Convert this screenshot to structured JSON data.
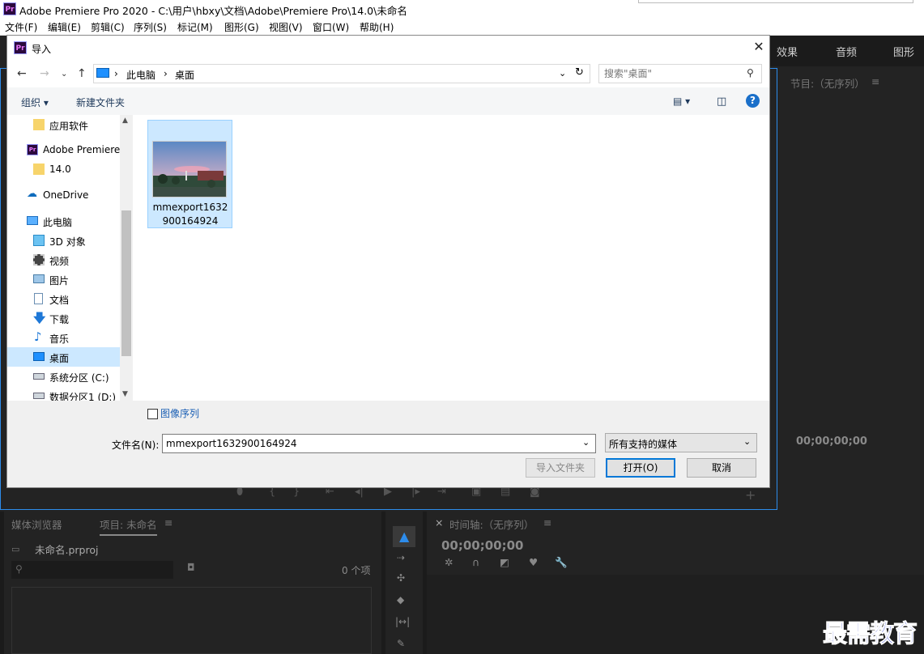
{
  "app": {
    "title": "Adobe Premiere Pro 2020 - C:\\用户\\hbxy\\文档\\Adobe\\Premiere Pro\\14.0\\未命名",
    "logo": "Pr"
  },
  "menu": [
    "文件(F)",
    "编辑(E)",
    "剪辑(C)",
    "序列(S)",
    "标记(M)",
    "图形(G)",
    "视图(V)",
    "窗口(W)",
    "帮助(H)"
  ],
  "premiere": {
    "tabs": [
      "效果",
      "音频",
      "图形"
    ],
    "program_label": "节目:（无序列）",
    "program_timecode": "00;00;00;00",
    "project_tabs": [
      "媒体浏览器",
      "项目: 未命名"
    ],
    "project_file": "未命名.prproj",
    "item_count": "0 个项",
    "timeline_label": "时间轴:（无序列）",
    "timeline_timecode": "00;00;00;00"
  },
  "dialog": {
    "title": "导入",
    "breadcrumb": [
      "此电脑",
      "桌面"
    ],
    "search_placeholder": "搜索\"桌面\"",
    "toolbar": {
      "organize": "组织",
      "new_folder": "新建文件夹"
    },
    "nav_items": [
      {
        "label": "应用软件",
        "icon": "folder-icon"
      },
      {
        "label": "Adobe Premiere",
        "icon": "premiere-icon"
      },
      {
        "label": "14.0",
        "icon": "folder-icon"
      },
      {
        "label": "OneDrive",
        "icon": "onedrive-icon"
      },
      {
        "label": "此电脑",
        "icon": "pc-icon"
      },
      {
        "label": "3D 对象",
        "icon": "cube-icon"
      },
      {
        "label": "视频",
        "icon": "video-icon"
      },
      {
        "label": "图片",
        "icon": "pictures-icon"
      },
      {
        "label": "文档",
        "icon": "document-icon"
      },
      {
        "label": "下载",
        "icon": "download-icon"
      },
      {
        "label": "音乐",
        "icon": "music-icon"
      },
      {
        "label": "桌面",
        "icon": "desktop-icon",
        "selected": true
      },
      {
        "label": "系统分区 (C:)",
        "icon": "drive-icon"
      },
      {
        "label": "数据分区1 (D:)",
        "icon": "drive-icon"
      }
    ],
    "file": {
      "name_line1": "mmexport1632",
      "name_line2": "900164924"
    },
    "image_sequence_label": "图像序列",
    "filename_label": "文件名(N):",
    "filename_value": "mmexport1632900164924",
    "filetype_value": "所有支持的媒体",
    "import_folder_btn": "导入文件夹",
    "open_btn": "打开(O)",
    "cancel_btn": "取消"
  },
  "watermark": "最需教育"
}
